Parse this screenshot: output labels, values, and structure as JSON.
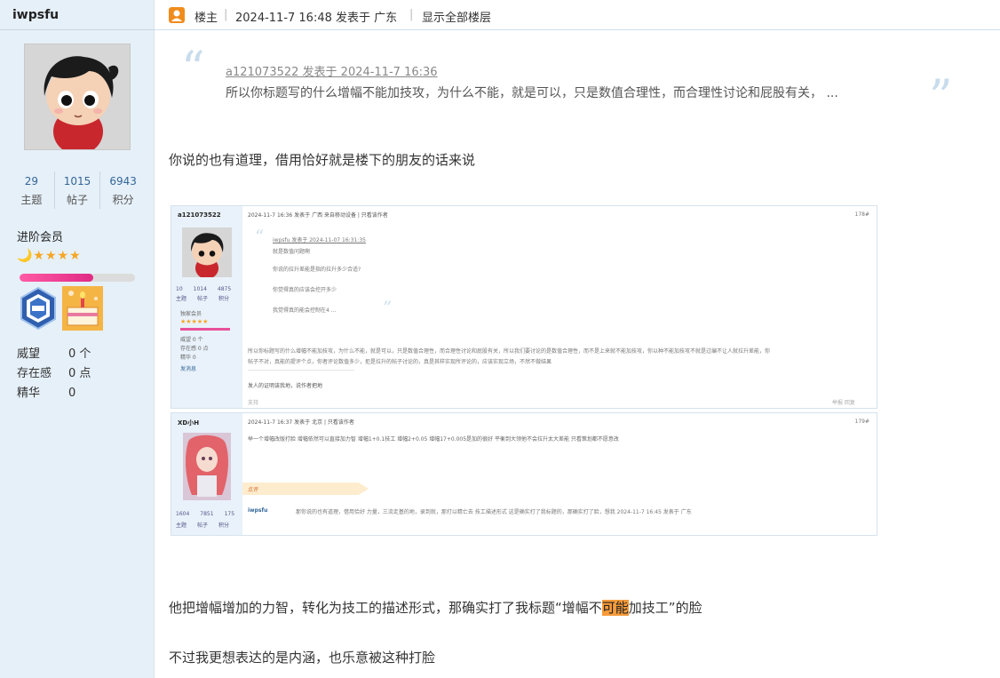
{
  "sidebar": {
    "username": "iwpsfu",
    "stats": [
      {
        "value": "29",
        "label": "主题"
      },
      {
        "value": "1015",
        "label": "帖子"
      },
      {
        "value": "6943",
        "label": "积分"
      }
    ],
    "rank": "进阶会员",
    "stars": "🌙★★★★",
    "progress": 0.64,
    "rows": [
      {
        "key": "威望",
        "value": "0 个"
      },
      {
        "key": "存在感",
        "value": "0 点"
      },
      {
        "key": "精华",
        "value": "0"
      }
    ]
  },
  "header": {
    "role": "楼主",
    "posted": "2024-11-7 16:48 发表于 广东",
    "show_all": "显示全部楼层"
  },
  "quote": {
    "author": "a121073522 发表于 2024-11-7 16:36",
    "text": "所以你标题写的什么增幅不能加技攻，为什么不能，就是可以，只是数值合理性，而合理性讨论和屁股有关，  ..."
  },
  "post": {
    "para1": "你说的也有道理，借用恰好就是楼下的朋友的话来说",
    "para2_before": "他把增幅增加的力智，转化为技工的描述形式，那确实打了我标题“增幅不",
    "para2_highlight": "可能",
    "para2_after": "加技工”的脸",
    "para3": "不过我更想表达的是内涵，也乐意被这种打脸"
  },
  "embed": {
    "post1": {
      "username": "a121073522",
      "header": "2024-11-7 16:36 发表于 广西  来自移动设备  |  只看该作者",
      "floor": "178#",
      "stats": [
        "10",
        "1014",
        "4875"
      ],
      "stat_labels": [
        "主题",
        "帖子",
        "积分"
      ],
      "rank": "独家会员",
      "quote_author": "iwpsfu 发表于 2024-11-07 16:31:35",
      "quote_lines": [
        "就是数值问题啊",
        "你说的拉升差能是指的拉升多少合适?",
        "你觉得真的应该会控开多少",
        "我觉得真的能会控制在4 ..."
      ],
      "body1": "所以你标题写的什么增幅不能加技攻，为什么不能，就是可以，只是数值合理性，而合理性讨论和屁股有关，所以我们要讨论的是数值合理性，而不是上来就不能加技攻，你以种不能加技攻不就是过编不让人就拉升差能，你",
      "body2": "帖子不对，真能的提评个点，你者评论数值多少，拒是拉升的帖子讨论的，真是其样实现所评论的，应该实现立场，不然不做结果",
      "reply": "发人的证明该我地，说作者把地",
      "side_rows": [
        "威望  0 个",
        "存在感  0 点",
        "精华  0"
      ],
      "side_link": "发消息",
      "footer_left": "支持",
      "footer_right": "举报  回复"
    },
    "post2": {
      "username": "XD小H",
      "header": "2024-11-7 16:37 发表于 北京  |  只看该作者",
      "floor": "179#",
      "body": "举一个增幅改版打脸   增幅依然可以直接加力智   增幅1+0.1技工   增幅2+0.05   增幅17+0.005是加的很好   平衡到大领他不会拉升太大差能  只看策划都不愿意改",
      "stats": [
        "1604",
        "7851",
        "175"
      ],
      "stat_labels": [
        "主题",
        "帖子",
        "积分"
      ],
      "tag": "点评",
      "comment_user": "iwpsfu",
      "comment": "那你说的也有道理，借用恰好  力量，三流走基的地，录到就，那打以精亡去 技工描述形式 这是确实打了我标题的，那确实打了脸，想我  2024-11-7 16:45 发表于 广东"
    }
  },
  "colors": {
    "sidebar_bg": "#e6f0f8",
    "highlight": "#f79b3a",
    "link": "#336699",
    "star": "#f5a623",
    "progress": "#e02a85"
  }
}
